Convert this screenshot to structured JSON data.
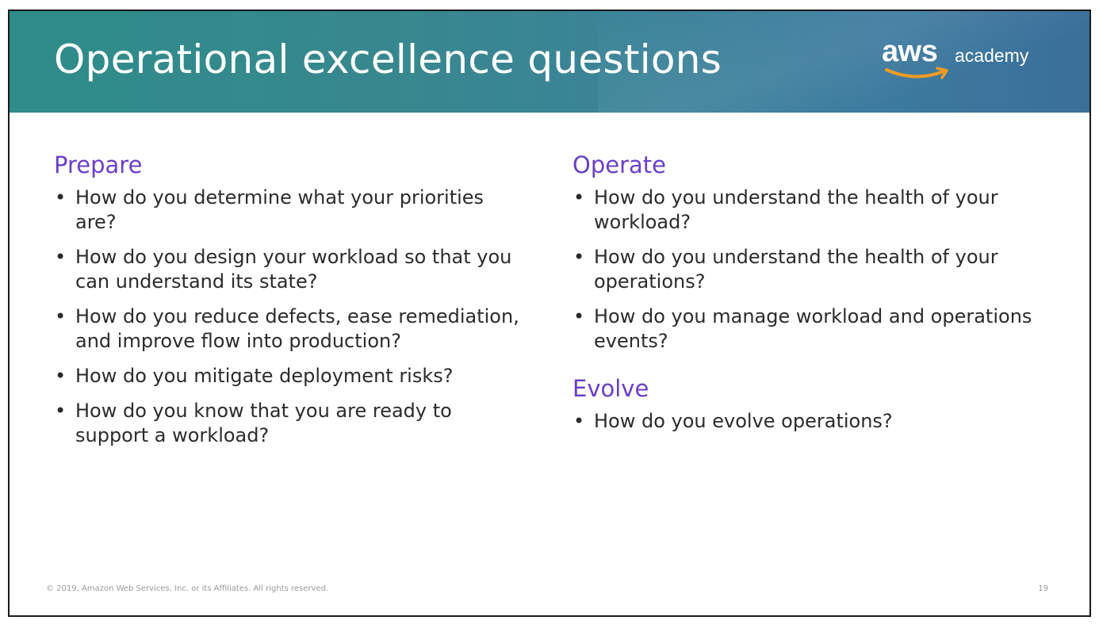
{
  "slide": {
    "title": "Operational excellence questions",
    "logo": {
      "brand": "aws",
      "suffix": "academy",
      "smile_color": "#f29a1e"
    },
    "colors": {
      "header_start": "#2e8c8a",
      "header_end": "#3a6f9a",
      "heading": "#6a3fc8",
      "body_text": "#2b2b2b"
    },
    "left_column": {
      "sections": [
        {
          "heading": "Prepare",
          "bullets": [
            "How do you determine what your priorities are?",
            "How do you design your workload so that you can understand its state?",
            "How do you reduce defects, ease remediation, and improve flow into production?",
            "How do you mitigate deployment risks?",
            "How do you know that you are ready to support a workload?"
          ]
        }
      ]
    },
    "right_column": {
      "sections": [
        {
          "heading": "Operate",
          "bullets": [
            "How do you understand the health of your workload?",
            "How do you understand the health of your operations?",
            "How do you manage workload and operations events?"
          ]
        },
        {
          "heading": "Evolve",
          "bullets": [
            "How do you evolve operations?"
          ]
        }
      ]
    },
    "footer": {
      "copyright": "© 2019, Amazon Web Services, Inc. or its Affiliates. All rights reserved.",
      "page_number": "19"
    }
  }
}
